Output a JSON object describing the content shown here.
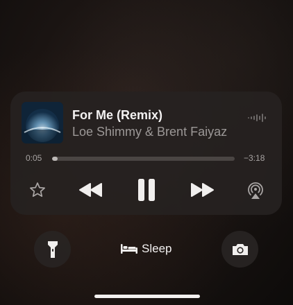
{
  "player": {
    "title": "For Me (Remix)",
    "artist": "Loe Shimmy & Brent Faiyaz",
    "time_elapsed": "0:05",
    "time_remaining": "−3:18",
    "progress": 0.03
  },
  "controls": {
    "favorite_icon": "star-icon",
    "rewind_icon": "rewind-icon",
    "playpause_icon": "pause-icon",
    "forward_icon": "fast-forward-icon",
    "airplay_icon": "airplay-audio-icon"
  },
  "lockscreen": {
    "flashlight_icon": "flashlight-icon",
    "camera_icon": "camera-icon",
    "focus_icon": "bed-icon",
    "focus_label": "Sleep"
  },
  "colors": {
    "accent_text": "#f4f2f2",
    "secondary_text": "#9c9897",
    "panel_bg": "#262221"
  }
}
